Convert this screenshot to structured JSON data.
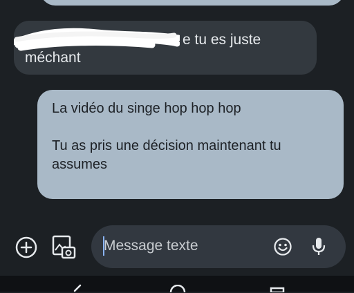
{
  "messages": [
    {
      "type": "outgoing-partial",
      "text": ""
    },
    {
      "type": "incoming",
      "line1": "e tu es juste",
      "line2": "méchant"
    },
    {
      "type": "outgoing",
      "para1": "La vidéo du singe hop hop hop",
      "para2": "Tu as pris une décision maintenant tu assumes"
    }
  ],
  "composer": {
    "placeholder": "Message texte",
    "add_icon": "plus-circle-icon",
    "gallery_icon": "gallery-icon",
    "emoji_icon": "emoji-icon",
    "mic_icon": "microphone-icon"
  },
  "colors": {
    "background": "#1c2024",
    "incoming_bubble": "#33393f",
    "outgoing_bubble": "#a9b9c7",
    "composer_bg": "#323840",
    "cursor": "#8ab4f8"
  },
  "navbar": {
    "back_icon": "back-icon",
    "home_icon": "home-icon",
    "recents_icon": "recents-icon"
  }
}
